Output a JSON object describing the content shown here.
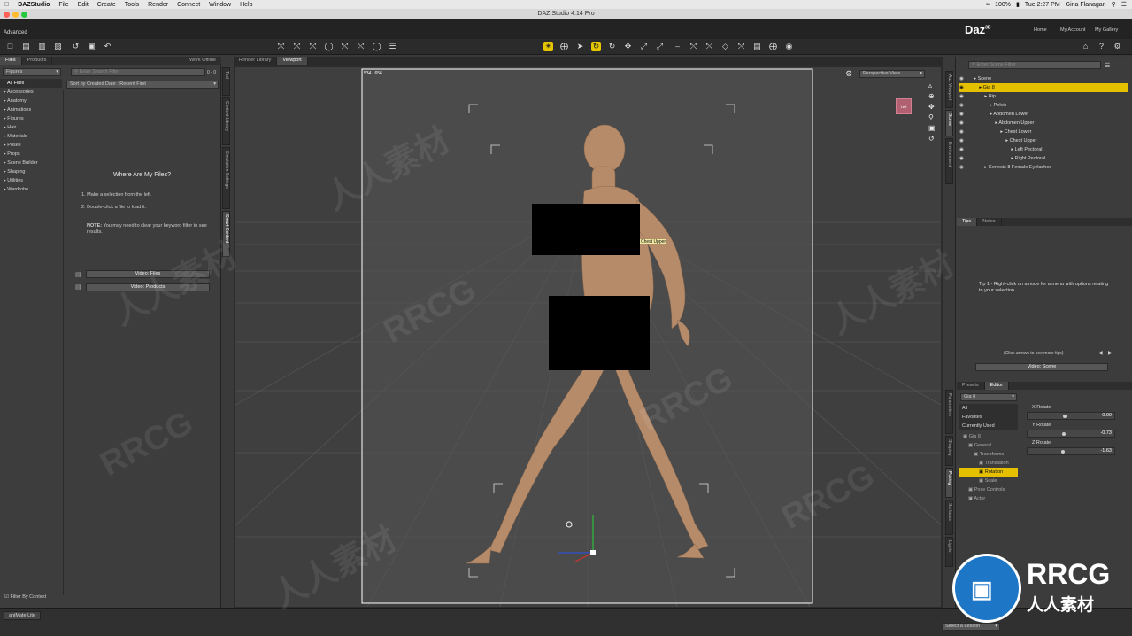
{
  "menubar": {
    "app_name": "DAZStudio",
    "items": [
      "File",
      "Edit",
      "Create",
      "Tools",
      "Render",
      "Connect",
      "Window",
      "Help"
    ],
    "battery": "100%",
    "clock": "Tue 2:27 PM",
    "user": "Gina Flanagan"
  },
  "window": {
    "title": "DAZ Studio 4.14 Pro"
  },
  "header": {
    "layout_label": "Advanced",
    "brand": "Daz",
    "brand_sup": "3D",
    "links": [
      "Home",
      "My Account",
      "My Gallery"
    ]
  },
  "left_panel": {
    "tabs": [
      "Files",
      "Products"
    ],
    "work_offline": "Work Offline",
    "folder_select": "Figures",
    "search_placeholder": "Enter Search Filter",
    "page_count": "0 - 0",
    "sort_label": "Sort by Created Date : Recent First",
    "categories": [
      "All Files",
      "Accessories",
      "Anatomy",
      "Animations",
      "Figures",
      "Hair",
      "Materials",
      "Poses",
      "Props",
      "Scene Builder",
      "Shaping",
      "Utilities",
      "Wardrobe"
    ],
    "help_title": "Where Are My Files?",
    "help_step1": "1. Make a selection from the left.",
    "help_step2": "2. Double-click a file to load it.",
    "help_note_label": "NOTE:",
    "help_note": "You may need to clear your keyword filter to see results.",
    "video_files": "Video: Files",
    "video_products": "Video: Products",
    "filter_by_context": "Filter By Context",
    "vertical_tabs": [
      "Tool",
      "Content Library",
      "Simulation Settings",
      "Smart Content"
    ]
  },
  "viewport": {
    "tabs": [
      "Render Library",
      "Viewport"
    ],
    "aspect_label": "534 : 656",
    "view_select": "Perspective View",
    "bone_tooltip": "Chest Upper"
  },
  "scene": {
    "search_placeholder": "Enter Scene Filter",
    "items": [
      {
        "label": "Scene",
        "indent": 0
      },
      {
        "label": "Gia 8",
        "indent": 1,
        "selected": true
      },
      {
        "label": "Hip",
        "indent": 2
      },
      {
        "label": "Pelvis",
        "indent": 3
      },
      {
        "label": "Abdomen Lower",
        "indent": 3
      },
      {
        "label": "Abdomen Upper",
        "indent": 4
      },
      {
        "label": "Chest Lower",
        "indent": 5
      },
      {
        "label": "Chest Upper",
        "indent": 6
      },
      {
        "label": "Left Pectoral",
        "indent": 7
      },
      {
        "label": "Right Pectoral",
        "indent": 7
      },
      {
        "label": "Genesis 8 Female Eyelashes",
        "indent": 2
      }
    ],
    "vertical_tabs": [
      "Aux Viewport",
      "Scene",
      "Environment"
    ]
  },
  "tips": {
    "tabs": [
      "Tips",
      "Notes"
    ],
    "text": "Tip 1 - Right-click on a node for a menu with options relating to your selection.",
    "more_tips": "(Click arrows to see more tips)",
    "video": "Video: Scene"
  },
  "parameters": {
    "tabs": [
      "Presets",
      "Editor"
    ],
    "node_select": "Gia 8",
    "filters": [
      "All",
      "Favorites",
      "Currently Used"
    ],
    "tree": [
      {
        "label": "Gia 8",
        "indent": 0
      },
      {
        "label": "General",
        "indent": 1
      },
      {
        "label": "Transforms",
        "indent": 2
      },
      {
        "label": "Translation",
        "indent": 3
      },
      {
        "label": "Rotation",
        "indent": 3,
        "selected": true
      },
      {
        "label": "Scale",
        "indent": 3
      },
      {
        "label": "Pose Controls",
        "indent": 1
      },
      {
        "label": "Actor",
        "indent": 1
      }
    ],
    "sliders": [
      {
        "label": "X Rotate",
        "value": "0.00",
        "fraction": 0.5
      },
      {
        "label": "Y Rotate",
        "value": "-0.73",
        "fraction": 0.49
      },
      {
        "label": "Z Rotate",
        "value": "-1.63",
        "fraction": 0.48
      }
    ],
    "vertical_tabs": [
      "Parameters",
      "Shaping",
      "Posing",
      "Surfaces",
      "Lights"
    ]
  },
  "status": {
    "lesson_select": "Select a Lesson",
    "bottom_tab": "aniMate Lite"
  },
  "watermarks": [
    "RRCG",
    "人人素材",
    "RRCG",
    "人人素材",
    "RRCG",
    "人人素材",
    "RRCG",
    "人人素材"
  ],
  "logo": {
    "main": "RRCG",
    "sub": "人人素材"
  },
  "colors": {
    "selection": "#e4c000",
    "background": "#3a3a3a",
    "viewport": "#404040"
  }
}
